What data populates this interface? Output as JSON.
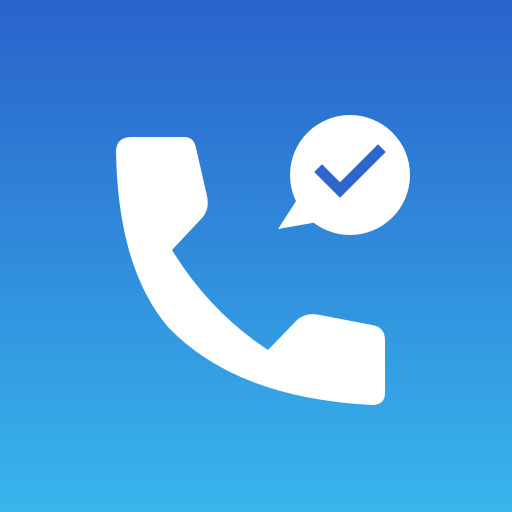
{
  "icon": {
    "name": "call-verified-app-icon",
    "elements": [
      "phone-handset-icon",
      "speech-bubble-icon",
      "checkmark-icon"
    ]
  },
  "colors": {
    "gradient_top": "#2962CB",
    "gradient_bottom": "#38B6EC",
    "glyph": "#FFFFFF",
    "checkmark": "#2E66CC"
  }
}
